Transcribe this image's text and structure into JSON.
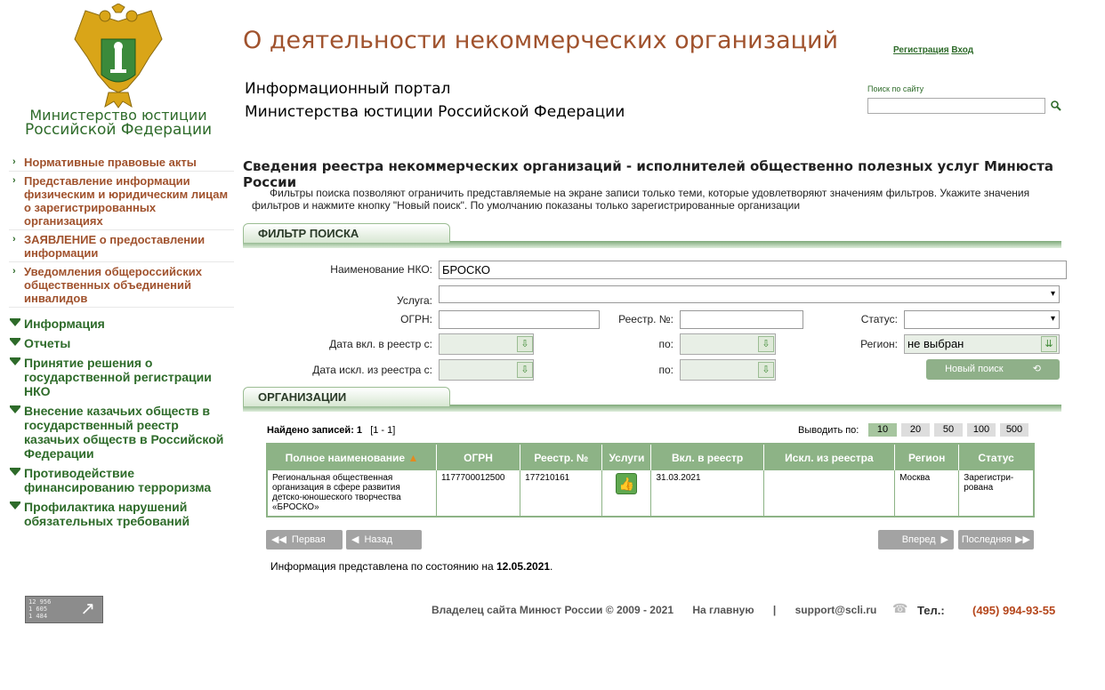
{
  "logo": {
    "line1": "Министерство юстиции",
    "line2": "Российской Федерации"
  },
  "header": {
    "site_title": "О деятельности некоммерческих организаций",
    "portal_line1": "Информационный портал",
    "portal_line2": "Министерства юстиции Российской Федерации",
    "register": "Регистрация",
    "login": "Вход",
    "search_label": "Поиск по сайту",
    "search_placeholder": ""
  },
  "nav_top": [
    "Нормативные правовые акты",
    "Представление информации физическим и юридическим лицам о зарегистрированных организациях",
    "ЗАЯВЛЕНИЕ о предоставлении информации",
    "Уведомления общероссийских общественных объединений инвалидов"
  ],
  "nav_sections": [
    "Информация",
    "Отчеты",
    "Принятие решения о государственной регистрации НКО",
    "Внесение казачьих обществ в государственный реестр казачьих обществ в Российской Федерации",
    "Противодействие финансированию терроризма",
    "Профилактика нарушений обязательных требований"
  ],
  "main": {
    "title": "Сведения реестра некоммерческих организаций - исполнителей общественно полезных услуг Минюста России",
    "intro": "Фильтры поиска позволяют ограничить представляемые на экране записи только теми, которые удовлетворяют значениям фильтров. Укажите значения фильтров и нажмите кнопку \"Новый поиск\". По умолчанию показаны только зарегистрированные организации"
  },
  "filter": {
    "section_title": "ФИЛЬТР ПОИСКА",
    "name_label": "Наименование НКО:",
    "name_value": "БРОСКО",
    "service_label": "Услуга:",
    "service_value": "",
    "ogrn_label": "ОГРН:",
    "ogrn_value": "",
    "reg_no_label": "Реестр. №:",
    "reg_no_value": "",
    "status_label": "Статус:",
    "status_value": "",
    "incl_from_label": "Дата вкл. в реестр с:",
    "to_label": "по:",
    "region_label": "Регион:",
    "region_value": "не выбран",
    "excl_from_label": "Дата искл. из реестра с:",
    "new_search": "Новый поиск"
  },
  "orgs": {
    "section_title": "ОРГАНИЗАЦИИ",
    "found_label": "Найдено записей: 1",
    "found_range": "[1 - 1]",
    "per_page_label": "Выводить по:",
    "per_page_options": [
      "10",
      "20",
      "50",
      "100",
      "500"
    ],
    "per_page_selected": "10",
    "columns": [
      "Полное наименование",
      "ОГРН",
      "Реестр. №",
      "Услуги",
      "Вкл. в реестр",
      "Искл. из реестра",
      "Регион",
      "Статус"
    ],
    "rows": [
      {
        "name": "Региональная общественная организация в сфере развития детско-юношеского творчества «БРОСКО»",
        "ogrn": "1177700012500",
        "reg_no": "177210161",
        "incl": "31.03.2021",
        "excl": "",
        "region": "Москва",
        "status": "Зарегистри-рована"
      }
    ],
    "pager": {
      "first": "Первая",
      "prev": "Назад",
      "next": "Вперед",
      "last": "Последняя"
    },
    "status_prefix": "Информация представлена по состоянию на ",
    "status_date": "12.05.2021"
  },
  "counter": {
    "line1": "12 956",
    "line2": "1 605",
    "line3": "1 484"
  },
  "footer": {
    "owner": "Владелец сайта Минюст России  © 2009 - 2021",
    "home": "На главную",
    "sep": "|",
    "email": "support@scli.ru",
    "phone_label": "Тел.:",
    "phone": "(495) 994-93-55"
  },
  "colors": {
    "brand_green": "#2e6b2a",
    "brand_brown": "#a0522d",
    "table_header": "#8db386",
    "phone": "#b5461b"
  }
}
